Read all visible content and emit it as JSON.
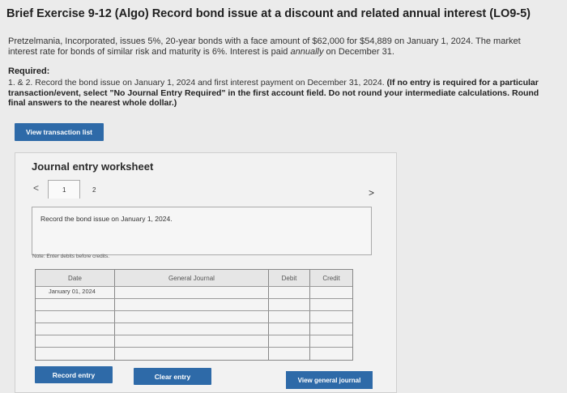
{
  "header": {
    "title": "Brief Exercise 9-12 (Algo) Record bond issue at a discount and related annual interest (LO9-5)"
  },
  "problem": {
    "text_before_em": "Pretzelmania, Incorporated, issues 5%, 20-year bonds with a face amount of $62,000 for $54,889 on January 1, 2024. The market interest rate for bonds of similar risk and maturity is 6%. Interest is paid ",
    "em": "annually",
    "text_after_em": " on December 31."
  },
  "required": {
    "heading": "Required:",
    "text": "1. & 2. Record the bond issue on January 1, 2024 and first interest payment on December 31, 2024.",
    "instructions": "(If no entry is required for a particular transaction/event, select \"No Journal Entry Required\" in the first account field. Do not round your intermediate calculations. Round final answers to the nearest whole dollar.)"
  },
  "buttons": {
    "view_transaction_list": "View transaction list",
    "record_entry": "Record entry",
    "clear_entry": "Clear entry",
    "view_general_journal": "View general journal"
  },
  "worksheet": {
    "title": "Journal entry worksheet",
    "prev_icon": "chevron-left-icon",
    "next_icon": "chevron-right-icon",
    "pages": [
      "1",
      "2"
    ],
    "description": "Record the bond issue on January 1, 2024.",
    "note": "Note: Enter debits before credits.",
    "columns": [
      "Date",
      "General Journal",
      "Debit",
      "Credit"
    ],
    "rows": [
      {
        "date": "January 01, 2024",
        "account": "",
        "debit": "",
        "credit": ""
      },
      {
        "date": "",
        "account": "",
        "debit": "",
        "credit": ""
      },
      {
        "date": "",
        "account": "",
        "debit": "",
        "credit": ""
      },
      {
        "date": "",
        "account": "",
        "debit": "",
        "credit": ""
      },
      {
        "date": "",
        "account": "",
        "debit": "",
        "credit": ""
      },
      {
        "date": "",
        "account": "",
        "debit": "",
        "credit": ""
      }
    ]
  },
  "colors": {
    "button_blue": "#2e6aa8"
  }
}
